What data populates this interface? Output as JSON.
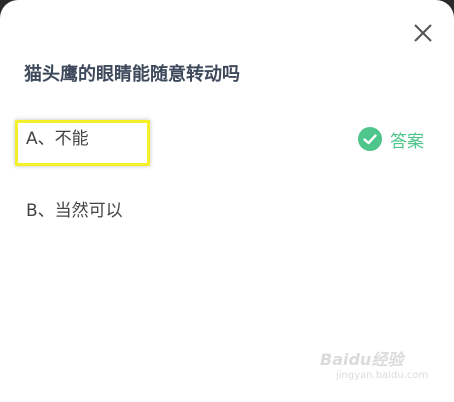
{
  "question": {
    "text": "猫头鹰的眼睛能随意转动吗"
  },
  "options": [
    {
      "label": "A、不能",
      "highlighted": true
    },
    {
      "label": "B、当然可以",
      "highlighted": false
    }
  ],
  "answer_tag": {
    "icon": "check-circle-icon",
    "label": "答案",
    "color": "#4ec58a"
  },
  "close": {
    "icon": "close-icon"
  },
  "highlight_color": "#f3ef28",
  "watermark": {
    "brand": "Baidu经验",
    "sub": "jingyan.baidu.com"
  }
}
